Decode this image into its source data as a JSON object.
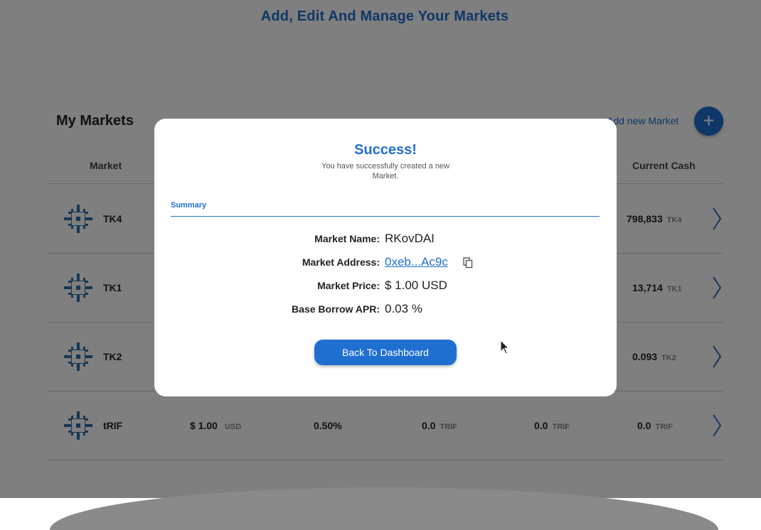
{
  "header": {
    "title": "Add, Edit And Manage Your Markets"
  },
  "markets": {
    "title": "My Markets",
    "add_label": "Add new Market",
    "add_icon": "plus-icon",
    "columns": {
      "market": "Market",
      "current_cash": "Current Cash"
    },
    "rows": [
      {
        "symbol": "TK4",
        "cash_value": "798,833",
        "cash_unit": "TK4"
      },
      {
        "symbol": "TK1",
        "cash_value": "13,714",
        "cash_unit": "TK1"
      },
      {
        "symbol": "TK2",
        "cash_value": "0.093",
        "cash_unit": "TK2"
      },
      {
        "symbol": "tRIF",
        "price_value": "$ 1.00",
        "price_unit": "USD",
        "rate": "0.50%",
        "supply_value": "0.0",
        "supply_unit": "TRIF",
        "borrow_value": "0.0",
        "borrow_unit": "TRIF",
        "cash_value": "0.0",
        "cash_unit": "TRIF"
      }
    ]
  },
  "modal": {
    "title": "Success!",
    "subtitle": "You have successfully created a new Market.",
    "tab": "Summary",
    "fields": [
      {
        "label": "Market Name:",
        "value": "RKovDAI"
      },
      {
        "label": "Market Address:",
        "value": "0xeb...Ac9c"
      },
      {
        "label": "Market Price:",
        "value": "$ 1.00 USD"
      },
      {
        "label": "Base Borrow APR:",
        "value": "0.03 %"
      }
    ],
    "copy_icon": "copy-icon",
    "button_label": "Back To Dashboard"
  },
  "colors": {
    "accent": "#1f6fd1",
    "overlay": "rgba(0,0,0,0.5)"
  }
}
